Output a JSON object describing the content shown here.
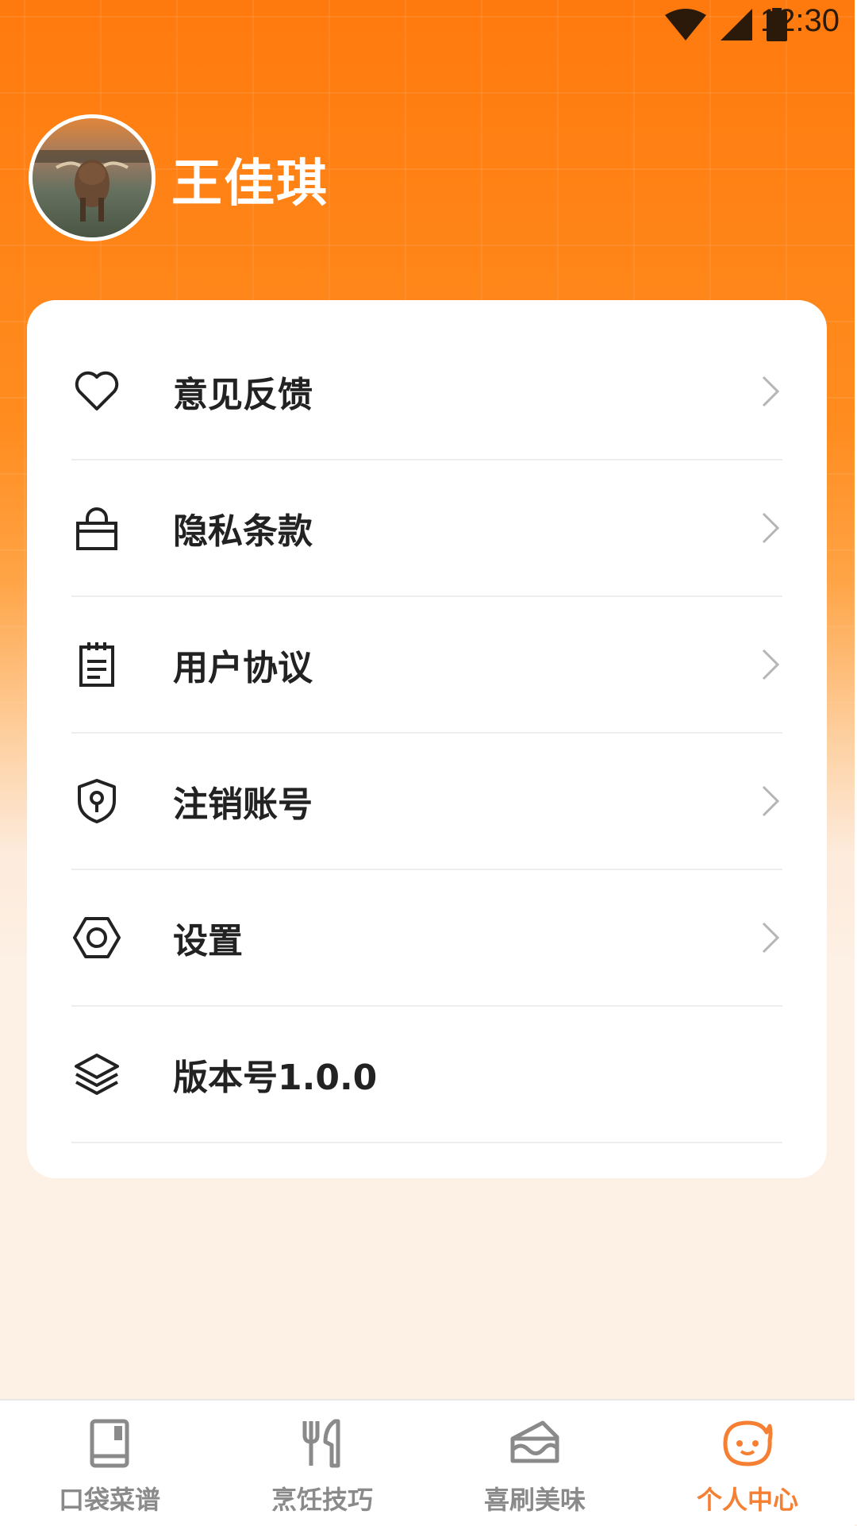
{
  "status_bar": {
    "time": "12:30"
  },
  "profile": {
    "name": "王佳琪"
  },
  "menu": {
    "items": [
      {
        "label": "意见反馈",
        "icon": "heart-icon",
        "has_chevron": true
      },
      {
        "label": "隐私条款",
        "icon": "lock-icon",
        "has_chevron": true
      },
      {
        "label": "用户协议",
        "icon": "clipboard-icon",
        "has_chevron": true
      },
      {
        "label": "注销账号",
        "icon": "shield-keyhole-icon",
        "has_chevron": true
      },
      {
        "label": "设置",
        "icon": "hexagon-nut-icon",
        "has_chevron": true
      },
      {
        "label": "版本号1.0.0",
        "icon": "layers-icon",
        "has_chevron": false
      }
    ]
  },
  "bottom_nav": {
    "items": [
      {
        "label": "口袋菜谱",
        "icon": "book-icon",
        "active": false
      },
      {
        "label": "烹饪技巧",
        "icon": "fork-knife-icon",
        "active": false
      },
      {
        "label": "喜刷美味",
        "icon": "cake-slice-icon",
        "active": false
      },
      {
        "label": "个人中心",
        "icon": "smiley-face-icon",
        "active": true
      }
    ]
  },
  "colors": {
    "accent": "#f57f33",
    "header_orange": "#ff7a0e",
    "inactive_nav": "#8a8a8a",
    "background": "#fdf1e6"
  }
}
